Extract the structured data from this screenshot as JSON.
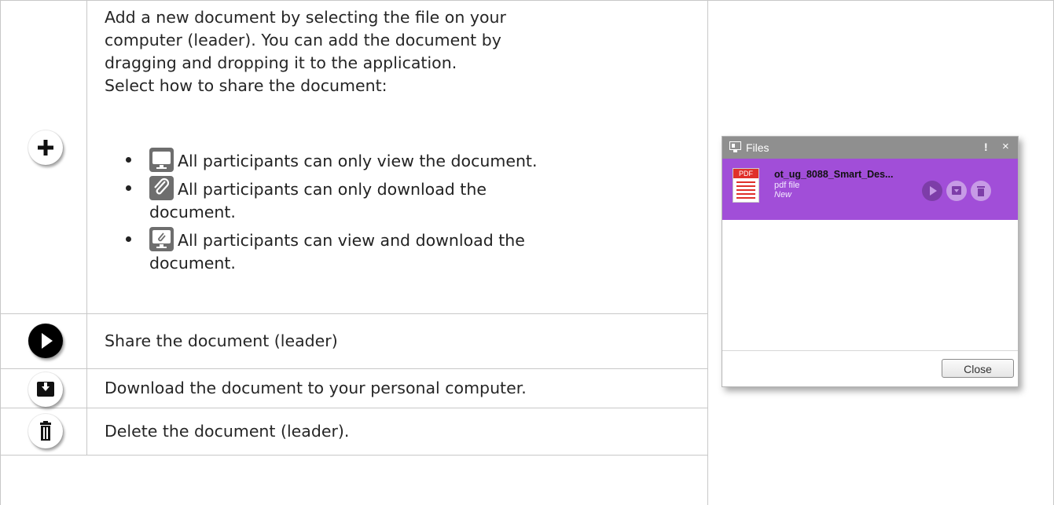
{
  "add_section": {
    "intro_lines": [
      "Add a new document by selecting the file on your",
      "computer (leader). You can add the document by",
      "dragging and dropping it to the application.",
      "Select how to share the document:"
    ],
    "share_options": [
      {
        "icon": "monitor-icon",
        "text_line1": "All participants can only view the document.",
        "text_line2": ""
      },
      {
        "icon": "paperclip-icon",
        "text_line1": "All participants can only download the",
        "text_line2": "document."
      },
      {
        "icon": "monitor-paperclip-icon",
        "text_line1": "All participants can view and download the",
        "text_line2": "document."
      }
    ]
  },
  "rows": [
    {
      "icon": "play-icon",
      "text": "Share the document (leader)"
    },
    {
      "icon": "download-icon",
      "text": "Download the document to your personal computer."
    },
    {
      "icon": "trash-icon",
      "text": "Delete the document (leader)."
    }
  ],
  "files_panel": {
    "title": "Files",
    "exclaim": "!",
    "close_glyph": "×",
    "file": {
      "badge": "PDF",
      "name": "ot_ug_8088_Smart_Des...",
      "type": "pdf file",
      "status": "New"
    },
    "close_button": "Close",
    "accent_color": "#a14ed8"
  }
}
